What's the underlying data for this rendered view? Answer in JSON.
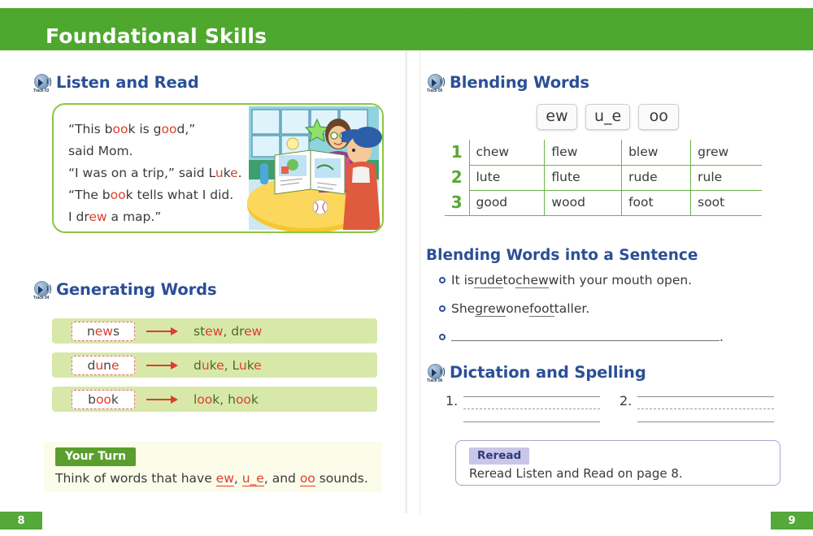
{
  "header": {
    "title": "Foundational Skills",
    "band_color": "#4ea82e"
  },
  "left_page": {
    "page_number": "8",
    "listen_and_read": {
      "title": "Listen and Read",
      "track": "Track 03",
      "icon": "audio-speaker-icon",
      "story_lines": [
        [
          {
            "t": "“This b",
            "h": false
          },
          {
            "t": "oo",
            "h": true
          },
          {
            "t": "k is g",
            "h": false
          },
          {
            "t": "oo",
            "h": true
          },
          {
            "t": "d,”",
            "h": false
          }
        ],
        [
          {
            "t": "said Mom.",
            "h": false
          }
        ],
        [
          {
            "t": "“I was on a trip,” said L",
            "h": false
          },
          {
            "t": "u",
            "h": true
          },
          {
            "t": "k",
            "h": false
          },
          {
            "t": "e",
            "h": true
          },
          {
            "t": ".",
            "h": false
          }
        ],
        [
          {
            "t": "“The b",
            "h": false
          },
          {
            "t": "oo",
            "h": true
          },
          {
            "t": "k tells what I did.",
            "h": false
          }
        ],
        [
          {
            "t": "I dr",
            "h": false
          },
          {
            "t": "ew",
            "h": true
          },
          {
            "t": " a map.”",
            "h": false
          }
        ]
      ],
      "illustration": "mother-and-boy-reading-book-illustration"
    },
    "generating_words": {
      "title": "Generating Words",
      "track": "Track 04",
      "icon": "audio-speaker-icon",
      "rows": [
        {
          "source": [
            {
              "t": "n",
              "h": false
            },
            {
              "t": "ew",
              "h": true
            },
            {
              "t": "s",
              "h": false
            }
          ],
          "result": [
            {
              "t": "st",
              "h": false
            },
            {
              "t": "ew",
              "h": true
            },
            {
              "t": ", dr",
              "h": false
            },
            {
              "t": "ew",
              "h": true
            }
          ]
        },
        {
          "source": [
            {
              "t": "d",
              "h": false
            },
            {
              "t": "u",
              "h": true
            },
            {
              "t": "n",
              "h": false
            },
            {
              "t": "e",
              "h": true
            }
          ],
          "result": [
            {
              "t": "d",
              "h": false
            },
            {
              "t": "u",
              "h": true
            },
            {
              "t": "k",
              "h": false
            },
            {
              "t": "e",
              "h": true
            },
            {
              "t": ", L",
              "h": false
            },
            {
              "t": "u",
              "h": true
            },
            {
              "t": "k",
              "h": false
            },
            {
              "t": "e",
              "h": true
            }
          ]
        },
        {
          "source": [
            {
              "t": "b",
              "h": false
            },
            {
              "t": "oo",
              "h": true
            },
            {
              "t": "k",
              "h": false
            }
          ],
          "result": [
            {
              "t": "l",
              "h": false
            },
            {
              "t": "oo",
              "h": true
            },
            {
              "t": "k, h",
              "h": false
            },
            {
              "t": "oo",
              "h": true
            },
            {
              "t": "k",
              "h": false
            }
          ]
        }
      ]
    },
    "your_turn": {
      "badge": "Your Turn",
      "text_parts": [
        {
          "t": "Think of words that have ",
          "u": false
        },
        {
          "t": "ew",
          "u": true
        },
        {
          "t": ", ",
          "u": false
        },
        {
          "t": "u_e",
          "u": true
        },
        {
          "t": ", and ",
          "u": false
        },
        {
          "t": "oo",
          "u": true
        },
        {
          "t": " sounds.",
          "u": false
        }
      ]
    }
  },
  "right_page": {
    "page_number": "9",
    "blending_words": {
      "title": "Blending Words",
      "track": "Track 05",
      "icon": "audio-speaker-icon",
      "chips": [
        "ew",
        "u_e",
        "oo"
      ],
      "table": {
        "rows": [
          {
            "number": "1",
            "words": [
              "chew",
              "flew",
              "blew",
              "grew"
            ]
          },
          {
            "number": "2",
            "words": [
              "lute",
              "flute",
              "rude",
              "rule"
            ]
          },
          {
            "number": "3",
            "words": [
              "good",
              "wood",
              "foot",
              "soot"
            ]
          }
        ]
      }
    },
    "blending_sentence": {
      "title": "Blending Words into a Sentence",
      "items": [
        {
          "parts": [
            {
              "t": "It is ",
              "u": false
            },
            {
              "t": "rude",
              "u": true
            },
            {
              "t": " to ",
              "u": false
            },
            {
              "t": "chew",
              "u": true
            },
            {
              "t": " with your mouth open.",
              "u": false
            }
          ],
          "blank": false
        },
        {
          "parts": [
            {
              "t": "She ",
              "u": false
            },
            {
              "t": "grew",
              "u": true
            },
            {
              "t": " one ",
              "u": false
            },
            {
              "t": "foot",
              "u": true
            },
            {
              "t": " taller.",
              "u": false
            }
          ],
          "blank": false
        },
        {
          "parts": [],
          "blank": true,
          "trailing": "."
        }
      ]
    },
    "dictation": {
      "title": "Dictation and Spelling",
      "track": "Track 06",
      "icon": "audio-speaker-icon",
      "items": [
        "1.",
        "2."
      ]
    },
    "reread": {
      "badge": "Reread",
      "text": "Reread Listen and Read on page 8."
    }
  }
}
